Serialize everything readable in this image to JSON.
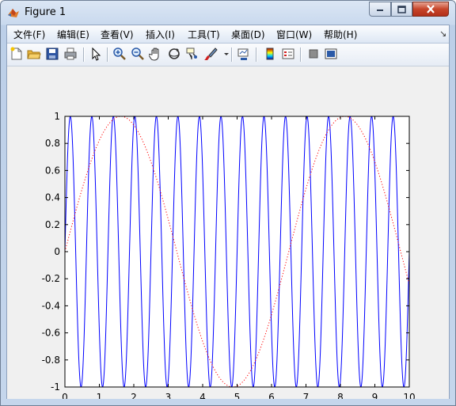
{
  "window": {
    "title": "Figure 1"
  },
  "menu": [
    "文件(F)",
    "编辑(E)",
    "查看(V)",
    "插入(I)",
    "工具(T)",
    "桌面(D)",
    "窗口(W)",
    "帮助(H)"
  ],
  "toolbar_icons": [
    "new-figure-icon",
    "open-file-icon",
    "save-icon",
    "print-icon",
    "pointer-icon",
    "zoom-in-icon",
    "zoom-out-icon",
    "pan-icon",
    "rotate-3d-icon",
    "data-cursor-icon",
    "brush-icon",
    "dropdown-arrow-icon",
    "link-plot-icon",
    "colorbar-icon",
    "legend-icon",
    "hide-plot-tools-icon",
    "show-plot-tools-icon"
  ],
  "chart_data": {
    "type": "line",
    "title": "",
    "xlabel": "",
    "ylabel": "",
    "xlim": [
      0,
      10
    ],
    "ylim": [
      -1,
      1
    ],
    "xticks": [
      "0",
      "1",
      "2",
      "3",
      "4",
      "5",
      "6",
      "7",
      "8",
      "9",
      "10"
    ],
    "yticks": [
      "1",
      "0.8",
      "0.6",
      "0.4",
      "0.2",
      "0",
      "-0.2",
      "-0.4",
      "-0.6",
      "-0.8",
      "-1"
    ],
    "grid": false,
    "series": [
      {
        "style": "solid",
        "color": "#0000ff",
        "function": "sin(2*pi*x/0.625)",
        "period": 0.625
      },
      {
        "style": "dotted",
        "color": "#ff0000",
        "function": "sin(2*pi*x/6.5)",
        "period": 6.5
      }
    ]
  }
}
